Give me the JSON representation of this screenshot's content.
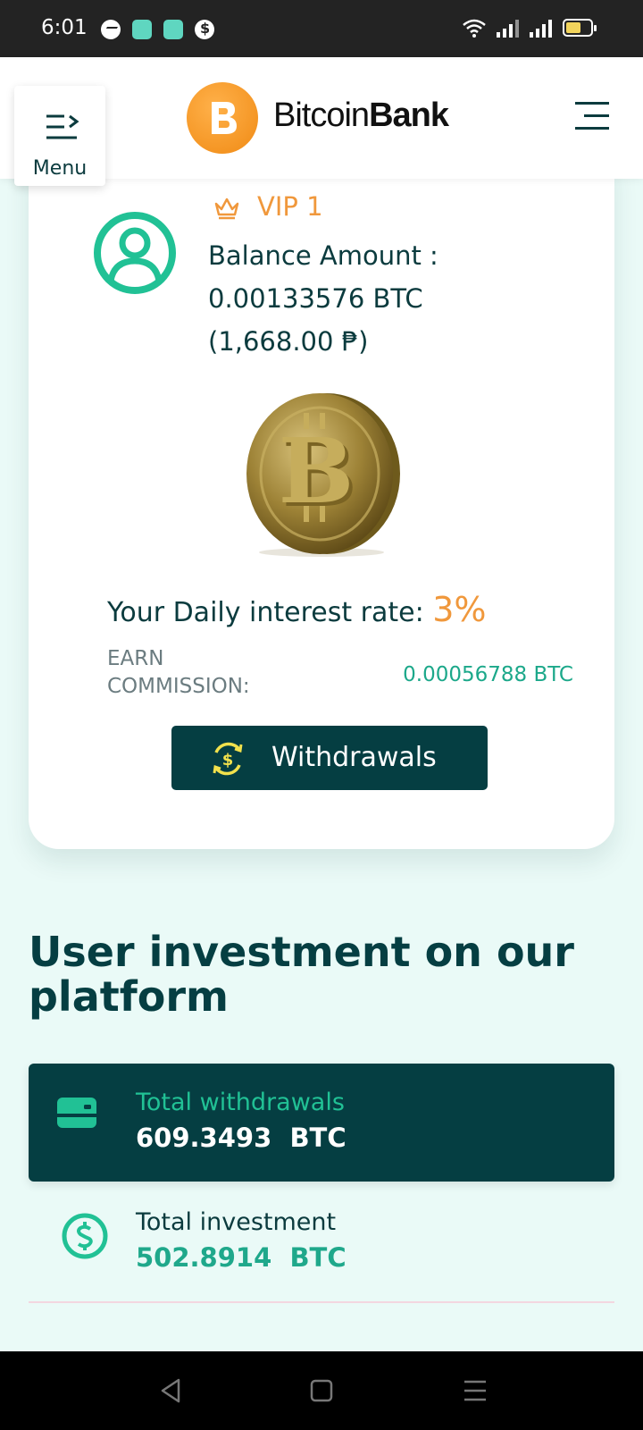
{
  "status_bar": {
    "time": "6:01",
    "notification_icons": [
      "messenger-icon",
      "app-icon",
      "app-icon",
      "app-icon"
    ],
    "system_icons": [
      "wifi-icon",
      "signal-icon",
      "signal-icon",
      "battery-icon"
    ]
  },
  "header": {
    "menu_label": "Menu",
    "brand_light": "Bitcoin",
    "brand_bold": "Bank",
    "colors": {
      "logo": "#f5961e",
      "text": "#0b3b3e"
    }
  },
  "profile": {
    "vip_label": "VIP 1",
    "balance_label": "Balance Amount :",
    "balance_btc": "0.00133576 BTC",
    "balance_fiat": "(1,668.00 ₱)"
  },
  "interest": {
    "label": "Your Daily interest rate: ",
    "rate": "3%"
  },
  "commission": {
    "label_line1": "EARN",
    "label_line2": "COMMISSION:",
    "value": "0.00056788 BTC"
  },
  "withdraw_button": {
    "label": "Withdrawals"
  },
  "investment_section": {
    "title": "User investment on our platform",
    "total_withdrawals": {
      "label": "Total withdrawals",
      "value": "609.3493  BTC"
    },
    "total_investment": {
      "label": "Total investment",
      "value": "502.8914  BTC"
    }
  },
  "theme": {
    "primary": "#053e42",
    "accent_teal": "#21c195",
    "accent_orange": "#f0983c",
    "background": "#eafaf7"
  }
}
